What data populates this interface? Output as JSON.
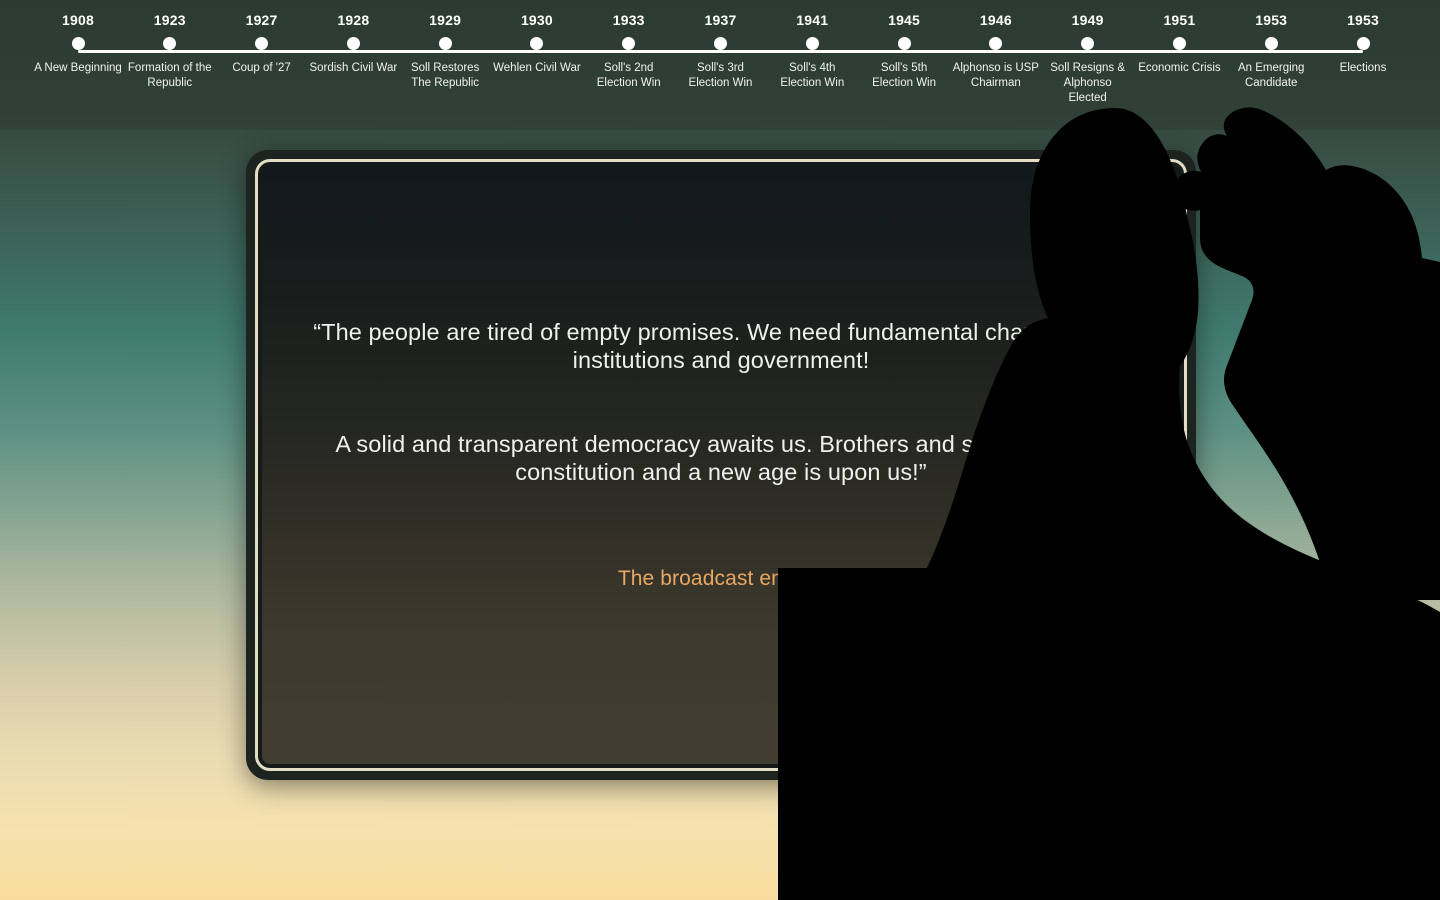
{
  "timeline": {
    "axis_color": "#ffffff",
    "events": [
      {
        "year": "1908",
        "label": "A New Beginning"
      },
      {
        "year": "1923",
        "label": "Formation of the Republic"
      },
      {
        "year": "1927",
        "label": "Coup of '27"
      },
      {
        "year": "1928",
        "label": "Sordish Civil War"
      },
      {
        "year": "1929",
        "label": "Soll Restores The Republic"
      },
      {
        "year": "1930",
        "label": "Wehlen Civil War"
      },
      {
        "year": "1933",
        "label": "Soll's 2nd Election Win"
      },
      {
        "year": "1937",
        "label": "Soll's 3rd Election Win"
      },
      {
        "year": "1941",
        "label": "Soll's 4th Election Win"
      },
      {
        "year": "1945",
        "label": "Soll's 5th Election Win"
      },
      {
        "year": "1946",
        "label": "Alphonso is USP Chairman"
      },
      {
        "year": "1949",
        "label": "Soll Resigns & Alphonso Elected"
      },
      {
        "year": "1951",
        "label": "Economic Crisis"
      },
      {
        "year": "1953",
        "label": "An Emerging Candidate"
      },
      {
        "year": "1953",
        "label": "Elections"
      }
    ]
  },
  "broadcast": {
    "speech_paragraph_1": "“The people are tired of empty promises. We need fundamental change in our institutions and government!",
    "speech_paragraph_2": "A solid and transparent democracy awaits us. Brothers and sisters, a new constitution and a new age is upon us!”",
    "status": "The broadcast ended.",
    "status_color": "#e9a762",
    "speech_color": "#eef0ec"
  },
  "scene": {
    "silhouette_color": "#000000",
    "background_top_color": "#34453b",
    "background_mid_color": "#3e7a6e",
    "background_bottom_color": "#fbdf9f",
    "tv_frame_color": "#1d2420",
    "tv_bezel_color": "#e3ddc4"
  }
}
